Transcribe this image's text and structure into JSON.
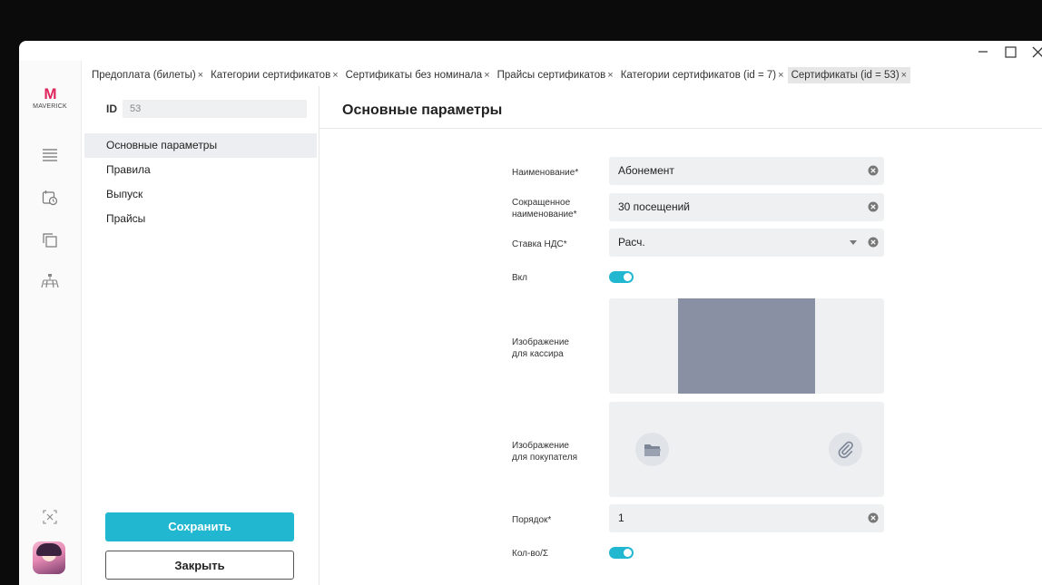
{
  "tabs": [
    {
      "label": "Предоплата (билеты)",
      "close": "×"
    },
    {
      "label": "Категории сертификатов",
      "close": "×"
    },
    {
      "label": "Сертификаты без номинала",
      "close": "×"
    },
    {
      "label": "Прайсы сертификатов",
      "close": "×"
    },
    {
      "label": "Категории сертификатов (id = 7)",
      "close": "×"
    },
    {
      "label": "Сертификаты (id = 53)",
      "close": "×"
    }
  ],
  "logo": {
    "mark_left": "M",
    "mark_right": "",
    "text": "MAVERICK"
  },
  "panel": {
    "id_label": "ID",
    "id_value": "53",
    "nav": [
      {
        "label": "Основные параметры"
      },
      {
        "label": "Правила"
      },
      {
        "label": "Выпуск"
      },
      {
        "label": "Прайсы"
      }
    ],
    "save_label": "Сохранить",
    "close_label": "Закрыть"
  },
  "main": {
    "title": "Основные параметры",
    "fields": {
      "name": {
        "label": "Наименование*",
        "value": "Абонемент"
      },
      "short_name": {
        "label_line1": "Сокращенное",
        "label_line2": "наименование*",
        "value": "30 посещений"
      },
      "vat": {
        "label": "Ставка НДС*",
        "value": "Расч."
      },
      "enabled": {
        "label": "Вкл",
        "on": true
      },
      "cashier_image": {
        "label_line1": "Изображение",
        "label_line2": "для кассира"
      },
      "buyer_image": {
        "label_line1": "Изображение",
        "label_line2": "для покупателя"
      },
      "order": {
        "label": "Порядок*",
        "value": "1"
      },
      "qty": {
        "label": "Кол-во/Σ",
        "on": true
      }
    }
  },
  "colors": {
    "accent": "#22b7d1",
    "preview": "#8a90a3",
    "field_bg": "#eef0f2"
  },
  "icons": [
    "minimize-icon",
    "maximize-icon",
    "close-icon",
    "menu-icon",
    "calendar-clock-icon",
    "copy-icon",
    "hierarchy-icon",
    "collapse-icon",
    "clear-icon",
    "dropdown-caret-icon",
    "folder-icon",
    "paperclip-icon"
  ]
}
